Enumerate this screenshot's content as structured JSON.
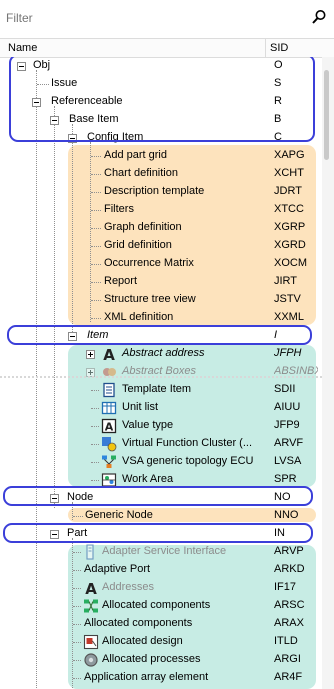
{
  "filter": {
    "placeholder": "Filter"
  },
  "columns": {
    "name": "Name",
    "sid": "SID"
  },
  "rows": [
    {
      "label": "Obj",
      "sid": "O"
    },
    {
      "label": "Issue",
      "sid": "S"
    },
    {
      "label": "Referenceable",
      "sid": "R"
    },
    {
      "label": "Base Item",
      "sid": "B"
    },
    {
      "label": "Config Item",
      "sid": "C"
    },
    {
      "label": "Add part grid",
      "sid": "XAPG"
    },
    {
      "label": "Chart definition",
      "sid": "XCHT"
    },
    {
      "label": "Description template",
      "sid": "JDRT"
    },
    {
      "label": "Filters",
      "sid": "XTCC"
    },
    {
      "label": "Graph definition",
      "sid": "XGRP"
    },
    {
      "label": "Grid definition",
      "sid": "XGRD"
    },
    {
      "label": "Occurrence Matrix",
      "sid": "XOCM"
    },
    {
      "label": "Report",
      "sid": "JIRT"
    },
    {
      "label": "Structure tree view",
      "sid": "JSTV"
    },
    {
      "label": "XML definition",
      "sid": "XXML"
    },
    {
      "label": "Item",
      "sid": "I"
    },
    {
      "label": "Abstract address",
      "sid": "JFPH"
    },
    {
      "label": "Abstract Boxes",
      "sid": "ABSINBX"
    },
    {
      "label": "Template Item",
      "sid": "SDII"
    },
    {
      "label": "Unit list",
      "sid": "AIUU"
    },
    {
      "label": "Value type",
      "sid": "JFP9"
    },
    {
      "label": "Virtual Function Cluster (...",
      "sid": "ARVF"
    },
    {
      "label": "VSA generic topology ECU",
      "sid": "LVSA"
    },
    {
      "label": "Work Area",
      "sid": "SPR"
    },
    {
      "label": "Node",
      "sid": "NO"
    },
    {
      "label": "Generic Node",
      "sid": "NNO"
    },
    {
      "label": "Part",
      "sid": "IN"
    },
    {
      "label": "Adapter Service Interface",
      "sid": "ARVP"
    },
    {
      "label": "Adaptive Port",
      "sid": "ARKD"
    },
    {
      "label": "Addresses",
      "sid": "IF17"
    },
    {
      "label": "Allocated components",
      "sid": "ARSC"
    },
    {
      "label": "Allocated components",
      "sid": "ARAX"
    },
    {
      "label": "Allocated design",
      "sid": "ITLD"
    },
    {
      "label": "Allocated processes",
      "sid": "ARGI"
    },
    {
      "label": "Application  array element",
      "sid": "AR4F"
    }
  ],
  "colors": {
    "orange_highlight": "#fde3bd",
    "teal_highlight": "#c7ece4",
    "annotation_box": "#3b3fd9"
  },
  "icons": {
    "search": "magnifier-icon",
    "abstract_address": "letter-a-icon",
    "abstract_boxes": "gear-cluster-icon",
    "template_item": "document-icon",
    "unit_list": "table-grid-icon",
    "value_type": "letter-a-box-icon",
    "virtual_function_cluster": "cluster-node-icon",
    "vsa_topology": "network-icon",
    "work_area": "workbench-icon",
    "adapter_service_interface": "interface-icon",
    "addresses": "letter-a-icon",
    "allocated_components": "component-tree-icon",
    "allocated_design": "design-icon",
    "allocated_processes": "process-gear-icon"
  }
}
